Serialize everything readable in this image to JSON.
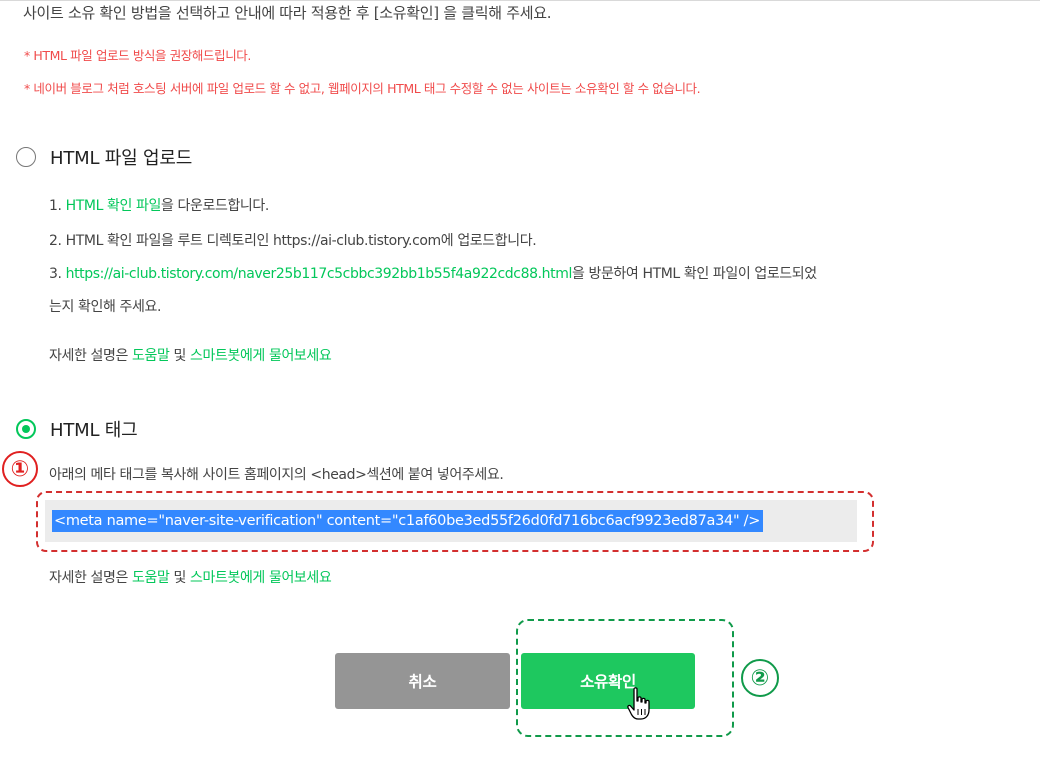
{
  "intro": "사이트 소유 확인 방법을 선택하고 안내에 따라 적용한 후 [소유확인] 을 클릭해 주세요.",
  "warnings": [
    "* HTML 파일 업로드 방식을 권장해드립니다.",
    "* 네이버 블로그 처럼 호스팅 서버에 파일 업로드 할 수 없고, 웹페이지의 HTML 태그 수정할 수 없는 사이트는 소유확인 할 수 없습니다."
  ],
  "option_file": {
    "label": "HTML 파일 업로드",
    "selected": false,
    "step1_prefix": "1. ",
    "step1_link": "HTML 확인 파일",
    "step1_suffix": "을 다운로드합니다.",
    "step2": "2. HTML 확인 파일을 루트 디렉토리인 https://ai-club.tistory.com에 업로드합니다.",
    "step3_prefix": "3. ",
    "step3_link": "https://ai-club.tistory.com/naver25b117c5cbbc392bb1b55f4a922cdc88.html",
    "step3_suffix": "을 방문하여 HTML 확인 파일이 업로드되었",
    "step3_cont": "는지 확인해 주세요."
  },
  "help": {
    "prefix": "자세한 설명은 ",
    "link1": "도움말",
    "middle": " 및 ",
    "link2": "스마트봇에게 물어보세요"
  },
  "option_tag": {
    "label": "HTML 태그",
    "selected": true,
    "description": "아래의 메타 태그를 복사해 사이트 홈페이지의 <head>섹션에 붙여 넣어주세요.",
    "meta_code": "<meta name=\"naver-site-verification\" content=\"c1af60be3ed55f26d0fd716bc6acf9923ed87a34\" />"
  },
  "buttons": {
    "cancel": "취소",
    "confirm": "소유확인"
  },
  "annotations": {
    "marker1": "①",
    "marker2": "②"
  },
  "colors": {
    "accent_green": "#03c75a",
    "warning_red": "#f04b4b",
    "selection_blue": "#3388ff",
    "annotation_red": "#d32f2f",
    "annotation_green": "#109a4a"
  }
}
